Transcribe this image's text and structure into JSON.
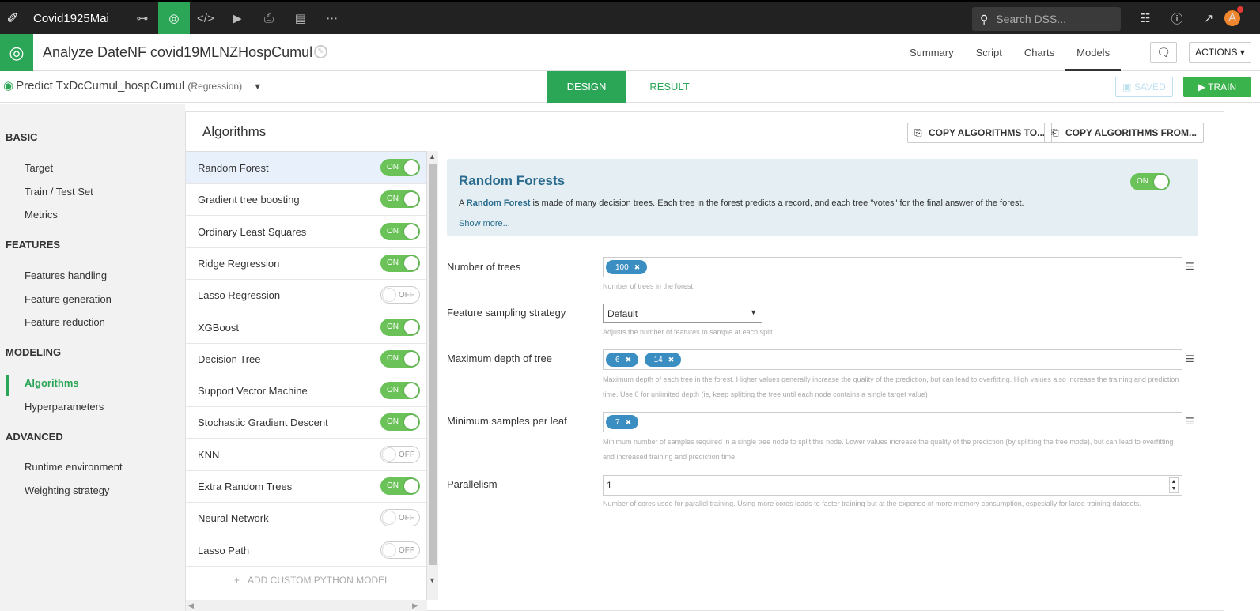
{
  "topbar": {
    "project_name": "Covid1925Mai",
    "search_placeholder": "Search DSS...",
    "avatar_initial": "A"
  },
  "header": {
    "title": "Analyze DateNF covid19MLNZHospCumul",
    "tabs": [
      {
        "label": "Summary"
      },
      {
        "label": "Script"
      },
      {
        "label": "Charts"
      },
      {
        "label": "Models"
      }
    ],
    "actions_label": "ACTIONS"
  },
  "subheader": {
    "predict_label": "Predict TxDcCumul_hospCumul",
    "predict_type": "(Regression)",
    "design_tab": "DESIGN",
    "result_tab": "RESULT",
    "saved_label": "SAVED",
    "train_label": "TRAIN"
  },
  "sidebar": {
    "sections": [
      {
        "title": "BASIC",
        "items": [
          "Target",
          "Train / Test Set",
          "Metrics"
        ]
      },
      {
        "title": "FEATURES",
        "items": [
          "Features handling",
          "Feature generation",
          "Feature reduction"
        ]
      },
      {
        "title": "MODELING",
        "items": [
          "Algorithms",
          "Hyperparameters"
        ]
      },
      {
        "title": "ADVANCED",
        "items": [
          "Runtime environment",
          "Weighting strategy"
        ]
      }
    ],
    "active_item": "Algorithms"
  },
  "panel": {
    "title": "Algorithms",
    "copy_to_label": "COPY ALGORITHMS TO...",
    "copy_from_label": "COPY ALGORITHMS FROM...",
    "add_custom_label": "ADD CUSTOM PYTHON MODEL"
  },
  "algorithms": [
    {
      "name": "Random Forest",
      "state": "ON"
    },
    {
      "name": "Gradient tree boosting",
      "state": "ON"
    },
    {
      "name": "Ordinary Least Squares",
      "state": "ON"
    },
    {
      "name": "Ridge Regression",
      "state": "ON"
    },
    {
      "name": "Lasso Regression",
      "state": "OFF"
    },
    {
      "name": "XGBoost",
      "state": "ON"
    },
    {
      "name": "Decision Tree",
      "state": "ON"
    },
    {
      "name": "Support Vector Machine",
      "state": "ON"
    },
    {
      "name": "Stochastic Gradient Descent",
      "state": "ON"
    },
    {
      "name": "KNN",
      "state": "OFF"
    },
    {
      "name": "Extra Random Trees",
      "state": "ON"
    },
    {
      "name": "Neural Network",
      "state": "OFF"
    },
    {
      "name": "Lasso Path",
      "state": "OFF"
    }
  ],
  "detail": {
    "title": "Random Forests",
    "toggle_state": "ON",
    "desc_prefix": "A ",
    "desc_bold": "Random Forest",
    "desc_rest": " is made of many decision trees. Each tree in the forest predicts a record, and each tree \"votes\" for the final answer of the forest.",
    "show_more": "Show more...",
    "params": {
      "num_trees": {
        "label": "Number of trees",
        "tags": [
          "100"
        ],
        "help": "Number of trees in the forest."
      },
      "feature_sampling": {
        "label": "Feature sampling strategy",
        "value": "Default",
        "help": "Adjusts the number of features to sample at each split."
      },
      "max_depth": {
        "label": "Maximum depth of tree",
        "tags": [
          "6",
          "14"
        ],
        "help": "Maximum depth of each tree in the forest. Higher values generally increase the quality of the prediction, but can lead to overfitting. High values also increase the training and prediction time. Use 0 for unlimited depth (ie, keep splitting the tree until each node contains a single target value)"
      },
      "min_samples": {
        "label": "Minimum samples per leaf",
        "tags": [
          "7"
        ],
        "help": "Minimum number of samples required in a single tree node to split this node. Lower values increase the quality of the prediction (by splitting the tree mode), but can lead to overfitting and increased training and prediction time."
      },
      "parallelism": {
        "label": "Parallelism",
        "value": "1",
        "help": "Number of cores used for parallel training. Using more cores leads to faster training but at the expense of more memory consumption, especially for large training datasets."
      }
    }
  },
  "colors": {
    "accent": "#2ba556",
    "toggle_on": "#6ac259",
    "tag": "#3b8ec1",
    "info_title": "#2a6b8e"
  }
}
